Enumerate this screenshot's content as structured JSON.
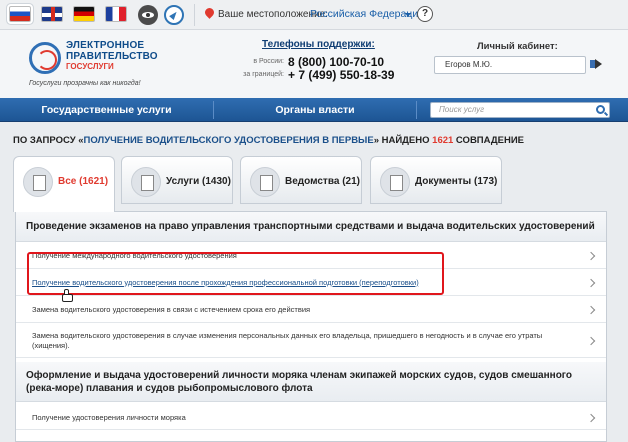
{
  "topbar": {
    "languages": [
      "ru",
      "en",
      "de",
      "fr"
    ],
    "location_label": "Ваше местоположение:",
    "location_value": "Российская Федерация",
    "help": "?"
  },
  "header": {
    "logo_line1": "ЭЛЕКТРОННОЕ",
    "logo_line2": "ПРАВИТЕЛЬСТВО",
    "logo_line3": "ГОСУСЛУГИ",
    "slogan": "Госуслуги прозрачны как никогда!",
    "support_title": "Телефоны поддержки",
    "support_ru_label": "в России:",
    "support_ru": "8 (800) 100-70-10",
    "support_abroad_label": "за границей:",
    "support_abroad": "+ 7 (499) 550-18-39",
    "cabinet_label": "Личный кабинет:",
    "cabinet_user": "Егоров М.Ю."
  },
  "nav": {
    "services": "Государственные услуги",
    "authorities": "Органы власти",
    "search_placeholder": "Поиск услуг"
  },
  "results": {
    "prefix": "По запросу «",
    "query": "получение водительского удостоверения в первые",
    "middle": "» найдено ",
    "count": "1621",
    "suffix": " совпадение"
  },
  "tabs": [
    {
      "label": "Все (1621)"
    },
    {
      "label": "Услуги (1430)"
    },
    {
      "label": "Ведомства (21)"
    },
    {
      "label": "Документы (173)"
    }
  ],
  "sections": [
    {
      "title": "Проведение экзаменов на право управления транспортными средствами и выдача водительских удостоверений",
      "items": [
        "Получение международного водительского удостоверения",
        "Получение водительского удостоверения после прохождения профессиональной подготовки (переподготовки)",
        "Замена водительского удостоверения в связи с истечением срока его действия",
        "Замена водительского удостоверения в случае изменения персональных данных его владельца, пришедшего в негодность и в случае его утраты (хищения)."
      ]
    },
    {
      "title": "Оформление и выдача удостоверений личности моряка членам экипажей морских судов, судов смешанного (река-море) плавания и судов рыбопромыслового флота",
      "items": [
        "Получение удостоверения личности моряка"
      ]
    }
  ],
  "colors": {
    "brand_blue": "#2f6db1",
    "accent_red": "#e03a2f",
    "highlight_red": "#e0161c"
  }
}
